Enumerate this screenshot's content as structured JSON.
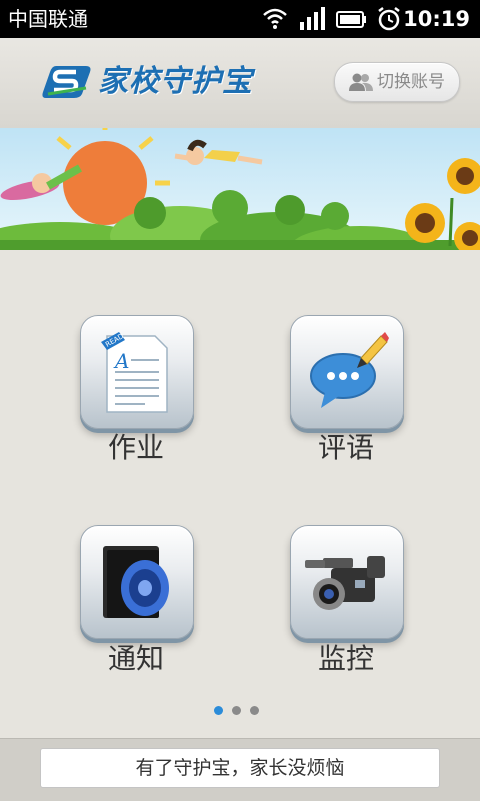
{
  "status_bar": {
    "carrier": "中国联通",
    "time": "10:19",
    "icons": [
      "wifi-icon",
      "signal-icon",
      "battery-icon",
      "alarm-icon"
    ]
  },
  "header": {
    "title": "家校守护宝",
    "logo_icon": "logo-icon",
    "switch_account_label": "切换账号",
    "switch_account_icon": "users-icon"
  },
  "banner": {
    "description_icons": [
      "sun-icon",
      "kids-icon",
      "sunflower-icon",
      "tree-icon"
    ]
  },
  "menu": [
    {
      "label": "作业",
      "icon": "document-icon"
    },
    {
      "label": "评语",
      "icon": "comment-icon"
    },
    {
      "label": "通知",
      "icon": "speaker-icon"
    },
    {
      "label": "监控",
      "icon": "camera-icon"
    }
  ],
  "pager": {
    "count": 3,
    "active": 0
  },
  "footer": {
    "slogan": "有了守护宝，家长没烦恼"
  },
  "colors": {
    "accent": "#1d6fb3",
    "dot_active": "#2b8cd9"
  }
}
